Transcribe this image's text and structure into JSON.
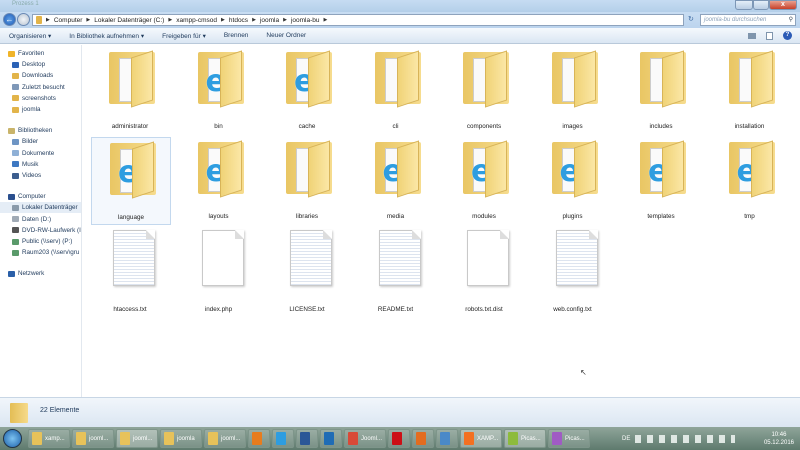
{
  "window": {
    "title": "Prozess 1",
    "close": "x"
  },
  "nav": {
    "back_icon": "←",
    "breadcrumb": [
      "Computer",
      "Lokaler Datenträger (C:)",
      "xampp-cmsod",
      "htdocs",
      "joomla",
      "joomla-bu"
    ],
    "search_placeholder": "joomla-bu durchsuchen",
    "search_icon": "⚲",
    "refresh_icon": "↻"
  },
  "toolbar": {
    "items": [
      "Organisieren ▾",
      "In Bibliothek aufnehmen ▾",
      "Freigeben für ▾",
      "Brennen",
      "Neuer Ordner"
    ],
    "help": "?"
  },
  "sidebar": {
    "items": [
      {
        "label": "Favoriten",
        "color": "#f0b429",
        "indent": 0,
        "sel": false
      },
      {
        "label": "Desktop",
        "color": "#2b62b5",
        "indent": 1,
        "sel": false
      },
      {
        "label": "Downloads",
        "color": "#e2b44a",
        "indent": 1,
        "sel": false
      },
      {
        "label": "Zuletzt besucht",
        "color": "#7f98b8",
        "indent": 1,
        "sel": false
      },
      {
        "label": "screenshots",
        "color": "#e2b44a",
        "indent": 1,
        "sel": false
      },
      {
        "label": "joomla",
        "color": "#e2b44a",
        "indent": 1,
        "sel": false
      },
      {
        "label": "Bibliotheken",
        "color": "#c9b46a",
        "indent": 0,
        "sel": false,
        "gap": true
      },
      {
        "label": "Bilder",
        "color": "#6e95c4",
        "indent": 1,
        "sel": false
      },
      {
        "label": "Dokumente",
        "color": "#8fb0d6",
        "indent": 1,
        "sel": false
      },
      {
        "label": "Musik",
        "color": "#3e78c2",
        "indent": 1,
        "sel": false
      },
      {
        "label": "Videos",
        "color": "#3c5e8e",
        "indent": 1,
        "sel": false
      },
      {
        "label": "Computer",
        "color": "#2a4f8e",
        "indent": 0,
        "sel": false,
        "gap": true
      },
      {
        "label": "Lokaler Datenträger",
        "color": "#8a9aaa",
        "indent": 1,
        "sel": true
      },
      {
        "label": "Daten (D:)",
        "color": "#a0aab5",
        "indent": 1,
        "sel": false
      },
      {
        "label": "DVD-RW-Laufwerk (I",
        "color": "#555",
        "indent": 1,
        "sel": false
      },
      {
        "label": "Public (\\\\serv) (P:)",
        "color": "#5a9a6a",
        "indent": 1,
        "sel": false
      },
      {
        "label": "Raum203 (\\\\serv\\gru",
        "color": "#5a9a6a",
        "indent": 1,
        "sel": false
      },
      {
        "label": "Netzwerk",
        "color": "#2a5fa8",
        "indent": 0,
        "sel": false,
        "gap": true
      }
    ]
  },
  "files": [
    {
      "name": "administrator",
      "type": "folder",
      "ie": false
    },
    {
      "name": "bin",
      "type": "folder",
      "ie": true
    },
    {
      "name": "cache",
      "type": "folder",
      "ie": true
    },
    {
      "name": "cli",
      "type": "folder",
      "ie": false
    },
    {
      "name": "components",
      "type": "folder",
      "ie": false
    },
    {
      "name": "images",
      "type": "folder",
      "ie": false
    },
    {
      "name": "includes",
      "type": "folder",
      "ie": false
    },
    {
      "name": "installation",
      "type": "folder",
      "ie": false
    },
    {
      "name": "language",
      "type": "folder",
      "ie": true,
      "sel": true
    },
    {
      "name": "layouts",
      "type": "folder",
      "ie": true
    },
    {
      "name": "libraries",
      "type": "folder",
      "ie": false
    },
    {
      "name": "media",
      "type": "folder",
      "ie": true
    },
    {
      "name": "modules",
      "type": "folder",
      "ie": true
    },
    {
      "name": "plugins",
      "type": "folder",
      "ie": true
    },
    {
      "name": "templates",
      "type": "folder",
      "ie": true
    },
    {
      "name": "tmp",
      "type": "folder",
      "ie": true
    },
    {
      "name": "htaccess.txt",
      "type": "txt"
    },
    {
      "name": "index.php",
      "type": "php"
    },
    {
      "name": "LICENSE.txt",
      "type": "txt"
    },
    {
      "name": "README.txt",
      "type": "txt"
    },
    {
      "name": "robots.txt.dist",
      "type": "php"
    },
    {
      "name": "web.config.txt",
      "type": "txt"
    }
  ],
  "ie_glyph": "e",
  "status": {
    "count": "22 Elemente"
  },
  "taskbar": {
    "items": [
      {
        "label": "xamp...",
        "color": "#e7c25a",
        "w": 42,
        "act": false
      },
      {
        "label": "jooml...",
        "color": "#e7c25a",
        "w": 42,
        "act": false
      },
      {
        "label": "jooml...",
        "color": "#e7c25a",
        "w": 42,
        "act": true
      },
      {
        "label": "joomla",
        "color": "#e7c25a",
        "w": 42,
        "act": false
      },
      {
        "label": "jooml...",
        "color": "#e7c25a",
        "w": 42,
        "act": false
      },
      {
        "label": "",
        "color": "#e77c1e",
        "w": 22,
        "act": false
      },
      {
        "label": "",
        "color": "#2e9de0",
        "w": 22,
        "act": false
      },
      {
        "label": "",
        "color": "#2b5797",
        "w": 22,
        "act": false
      },
      {
        "label": "",
        "color": "#1f6cb5",
        "w": 22,
        "act": false
      },
      {
        "label": "Jooml...",
        "color": "#d94a38",
        "w": 42,
        "act": false
      },
      {
        "label": "",
        "color": "#cc0f16",
        "w": 22,
        "act": false
      },
      {
        "label": "",
        "color": "#e36c1f",
        "w": 22,
        "act": false
      },
      {
        "label": "",
        "color": "#4a89c8",
        "w": 22,
        "act": false
      },
      {
        "label": "XAMP...",
        "color": "#f37021",
        "w": 42,
        "act": true
      },
      {
        "label": "Picas...",
        "color": "#8dbb3c",
        "w": 42,
        "act": true
      },
      {
        "label": "Picas...",
        "color": "#a05bc4",
        "w": 42,
        "act": false
      }
    ],
    "lang": "DE",
    "time": "10:46",
    "date": "05.12.2016"
  }
}
